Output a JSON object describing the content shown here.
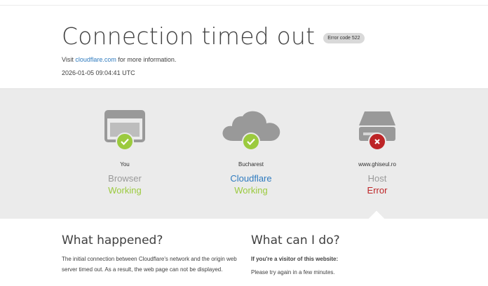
{
  "header": {
    "title": "Connection timed out",
    "error_badge": "Error code 522",
    "visit_prefix": "Visit ",
    "visit_link": "cloudflare.com",
    "visit_suffix": " for more information.",
    "timestamp": "2026-01-05 09:04:41 UTC"
  },
  "nodes": [
    {
      "location": "You",
      "role": "Browser",
      "status": "Working",
      "icon": "browser-window-icon",
      "status_icon": "check-icon"
    },
    {
      "location": "Bucharest",
      "role": "Cloudflare",
      "status": "Working",
      "icon": "cloud-icon",
      "status_icon": "check-icon"
    },
    {
      "location": "www.ghiseul.ro",
      "role": "Host",
      "status": "Error",
      "icon": "server-icon",
      "status_icon": "x-icon"
    }
  ],
  "what_happened": {
    "heading": "What happened?",
    "body": "The initial connection between Cloudflare's network and the origin web server timed out. As a result, the web page can not be displayed."
  },
  "what_can_i_do": {
    "heading": "What can I do?",
    "subheading": "If you're a visitor of this website:",
    "body": "Please try again in a few minutes."
  },
  "colors": {
    "ok": "#9bca3e",
    "error": "#bd2426",
    "link": "#2f7bbf",
    "icon_gray": "#999999",
    "band": "#ebebeb"
  }
}
